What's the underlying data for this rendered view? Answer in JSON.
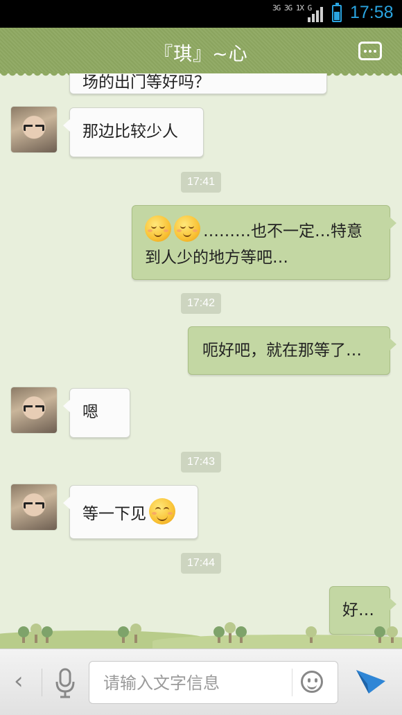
{
  "status_bar": {
    "network_top": "3G 3G 1X G",
    "time": "17:58",
    "colors": {
      "accent": "#2aa4e0"
    }
  },
  "header": {
    "title": "『琪』~心",
    "more_icon": "more-dots-icon",
    "color": "#8fa962"
  },
  "chat": {
    "top_partial_text": "场的出门等好吗？",
    "messages": [
      {
        "type": "incoming",
        "text": "那边比较少人"
      },
      {
        "type": "time",
        "text": "17:41"
      },
      {
        "type": "outgoing",
        "emoji_count": 2,
        "line1": "………也不一定…特意",
        "line2": "到人少的地方等吧…"
      },
      {
        "type": "time",
        "text": "17:42"
      },
      {
        "type": "outgoing",
        "text": "呃好吧，就在那等了…"
      },
      {
        "type": "incoming",
        "text": "嗯"
      },
      {
        "type": "time",
        "text": "17:43"
      },
      {
        "type": "incoming",
        "text": "等一下见",
        "emoji": "smile-emoji"
      },
      {
        "type": "time",
        "text": "17:44"
      },
      {
        "type": "outgoing",
        "text": "好…"
      }
    ],
    "colors": {
      "outgoing_bubble": "#c3d7a3",
      "incoming_bubble": "#fbfbfb",
      "background": "#e8efdc"
    }
  },
  "input_bar": {
    "back_symbol": "‹",
    "placeholder": "请输入文字信息",
    "mic_icon": "microphone-icon",
    "emoji_icon": "smiley-icon",
    "send_icon": "send-arrow-icon",
    "send_color": "#2f86d6"
  }
}
